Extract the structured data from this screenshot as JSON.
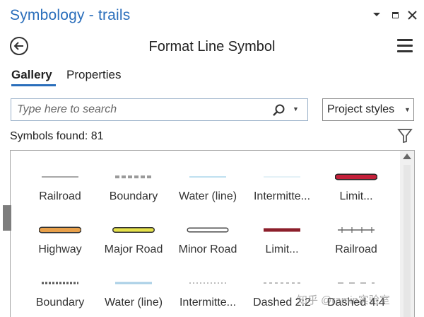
{
  "window": {
    "title": "Symbology - trails",
    "controls": [
      "chevron-down-icon",
      "maximize-icon",
      "close-icon"
    ]
  },
  "header": {
    "title": "Format Line Symbol"
  },
  "tabs": [
    {
      "label": "Gallery",
      "active": true
    },
    {
      "label": "Properties",
      "active": false
    }
  ],
  "search": {
    "placeholder": "Type here to search",
    "value": ""
  },
  "styles_dropdown": {
    "selected": "Project styles"
  },
  "symbols_found": "Symbols found: 81",
  "gallery": {
    "items": [
      {
        "label": "Railroad",
        "style": "thin-grey"
      },
      {
        "label": "Boundary",
        "style": "dash-grey"
      },
      {
        "label": "Water (line)",
        "style": "thin-lightblue"
      },
      {
        "label": "Intermitte...",
        "style": "faint-blue"
      },
      {
        "label": "Limit...",
        "style": "outlined-red"
      },
      {
        "label": "Highway",
        "style": "outlined-orange"
      },
      {
        "label": "Major Road",
        "style": "outlined-yellow"
      },
      {
        "label": "Minor Road",
        "style": "outlined-white"
      },
      {
        "label": "Limit...",
        "style": "solid-maroon"
      },
      {
        "label": "Railroad",
        "style": "hatched-grey"
      },
      {
        "label": "Boundary",
        "style": "dotted-dark"
      },
      {
        "label": "Water (line)",
        "style": "mid-lightblue"
      },
      {
        "label": "Intermitte...",
        "style": "dotted-grey"
      },
      {
        "label": "Dashed 2:2",
        "style": "dash-light"
      },
      {
        "label": "Dashed 4:4",
        "style": "dash-long-light"
      }
    ]
  },
  "colors": {
    "title_blue": "#2a6ebb",
    "accent_underline": "#2a6ebb",
    "maroon": "#8c1f2b",
    "orange": "#e8a04a",
    "yellow": "#e6e24a"
  },
  "watermark": "知乎 @ramin实验室"
}
